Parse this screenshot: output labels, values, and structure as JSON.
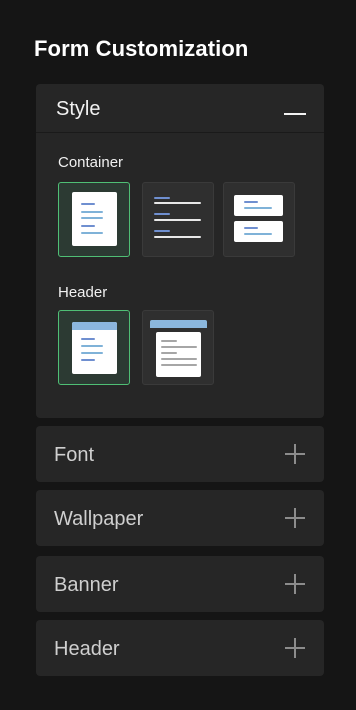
{
  "panel": {
    "title": "Form Customization"
  },
  "style_section": {
    "label": "Style",
    "container_label": "Container",
    "header_label": "Header",
    "container_options": [
      "centered-card",
      "full-width-lines",
      "split-cards"
    ],
    "header_options": [
      "banner-header",
      "floating-header"
    ],
    "selected_container": "centered-card",
    "selected_header": "banner-header"
  },
  "collapsed_sections": [
    {
      "label": "Font"
    },
    {
      "label": "Wallpaper"
    },
    {
      "label": "Banner"
    },
    {
      "label": "Header"
    }
  ],
  "colors": {
    "background": "#151515",
    "section": "#262626",
    "selected_border": "#4fbf75",
    "accent_line": "#7fb2d8"
  }
}
